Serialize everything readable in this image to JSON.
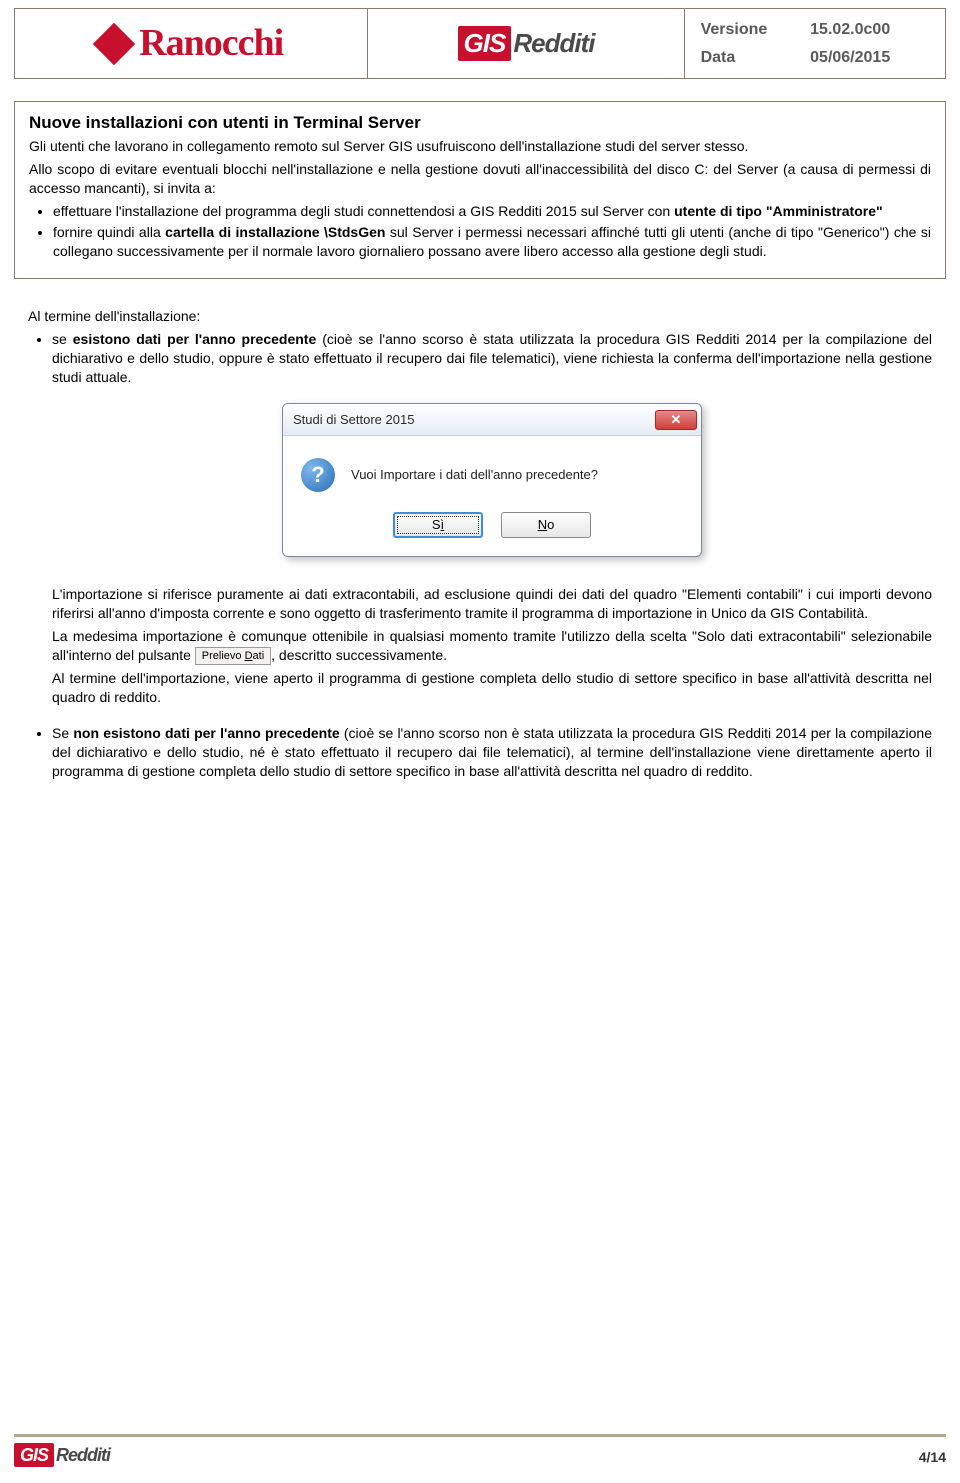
{
  "header": {
    "logo_text": "Ranocchi",
    "product_prefix": "GIS",
    "product_suffix": "Redditi",
    "meta": {
      "version_label": "Versione",
      "version_value": "15.02.0c00",
      "date_label": "Data",
      "date_value": "05/06/2015"
    }
  },
  "box": {
    "title": "Nuove installazioni con utenti in Terminal Server",
    "p1": "Gli utenti che lavorano in collegamento remoto sul Server GIS usufruiscono dell'installazione studi del server stesso.",
    "p2": "Allo scopo di evitare eventuali blocchi nell'installazione e nella gestione dovuti all'inaccessibilità del disco C: del Server (a causa di permessi di accesso mancanti), si invita a:",
    "bullets": [
      {
        "pre": "effettuare l'installazione del programma degli studi connettendosi a GIS Redditi 2015 sul Server con ",
        "bold": "utente di tipo \"Amministratore\"",
        "post": ""
      },
      {
        "pre": "fornire quindi alla ",
        "bold": "cartella di installazione \\StdsGen",
        "post": " sul Server i permessi necessari affinché tutti gli utenti (anche di tipo \"Generico\") che si collegano successivamente per il normale lavoro giornaliero possano avere libero accesso alla gestione degli studi."
      }
    ]
  },
  "body": {
    "intro": "Al termine dell'installazione:",
    "item1": {
      "pre": "se ",
      "bold": "esistono dati per l'anno precedente",
      "post": " (cioè se l'anno scorso è stata utilizzata la procedura GIS Redditi 2014 per la compilazione del dichiarativo e dello studio, oppure è stato effettuato il recupero dai file telematici), viene richiesta la conferma dell'importazione nella gestione studi attuale."
    },
    "dialog": {
      "title": "Studi di Settore 2015",
      "message": "Vuoi Importare i dati dell'anno precedente?",
      "yes_pre": "S",
      "yes_under": "ì",
      "no_under": "N",
      "no_post": "o",
      "close": "✕",
      "icon": "?"
    },
    "after_dialog": {
      "p1": "L'importazione si riferisce puramente ai dati extracontabili, ad esclusione quindi dei dati del quadro \"Elementi contabili\" i cui importi devono riferirsi all'anno d'imposta corrente e sono oggetto di trasferimento tramite il programma di importazione in Unico da GIS Contabilità.",
      "p2a": "La medesima importazione è comunque ottenibile in qualsiasi momento tramite l'utilizzo della scelta \"Solo dati extracontabili\" selezionabile all'interno del pulsante ",
      "btn_pre": "Prelievo ",
      "btn_under": "D",
      "btn_post": "ati",
      "p2b": ", descritto successivamente.",
      "p3": "Al termine dell'importazione, viene aperto il programma di gestione completa dello studio di settore specifico in base all'attività descritta nel quadro di reddito."
    },
    "item2": {
      "pre": "Se ",
      "bold": "non esistono dati per l'anno precedente",
      "post": " (cioè se l'anno scorso non è stata utilizzata la procedura GIS Redditi 2014 per la compilazione del dichiarativo e dello studio, né è stato effettuato il recupero dai file telematici), al termine dell'installazione viene direttamente aperto il programma di gestione completa dello studio di settore specifico in base all'attività descritta nel quadro di reddito."
    }
  },
  "footer": {
    "product_prefix": "GIS",
    "product_suffix": "Redditi",
    "page": "4/14"
  }
}
